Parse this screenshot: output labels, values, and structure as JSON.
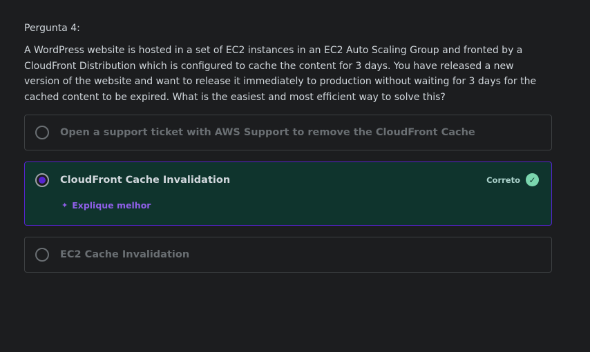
{
  "question": {
    "number_label": "Pergunta 4:",
    "text": "A WordPress website is hosted in a set of EC2 instances in an EC2 Auto Scaling Group and fronted by a CloudFront Distribution which is configured to cache the content for 3 days. You have released a new version of the website and want to release it immediately to production without waiting for 3 days for the cached content to be expired. What is the easiest and most efficient way to solve this?"
  },
  "options": [
    {
      "label": "Open a support ticket with AWS Support to remove the CloudFront Cache",
      "selected": false
    },
    {
      "label": "CloudFront Cache Invalidation",
      "selected": true,
      "status": "Correto",
      "explain_label": "Explique melhor"
    },
    {
      "label": "EC2 Cache Invalidation",
      "selected": false
    }
  ],
  "colors": {
    "accent": "#5624d0",
    "correct_bg": "#0f342d",
    "check": "#7bd6ae",
    "explain": "#8f5fe8"
  }
}
